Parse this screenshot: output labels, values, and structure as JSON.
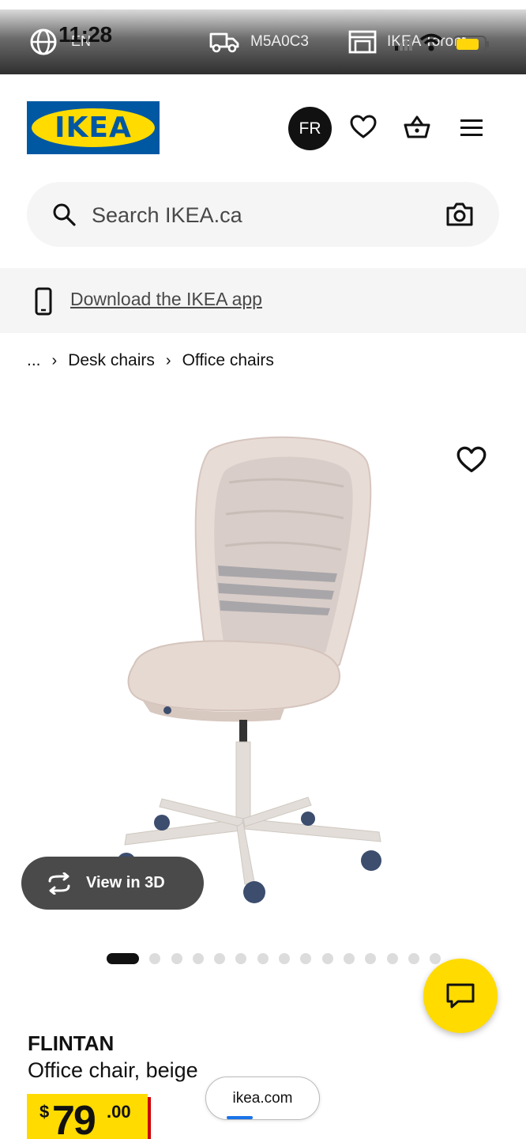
{
  "topbar": {
    "language": "EN",
    "time": "11:28",
    "postal_code": "M5A0C3",
    "store": "IKEA Toront..."
  },
  "header": {
    "logo_text": "IKEA",
    "lang_toggle": "FR",
    "icons": [
      "heart-icon",
      "basket-icon",
      "menu-icon"
    ]
  },
  "search": {
    "placeholder": "Search IKEA.ca"
  },
  "app_banner": {
    "link_text": "Download the IKEA app"
  },
  "breadcrumb": {
    "items": [
      "...",
      "Desk chairs",
      "Office chairs"
    ]
  },
  "gallery": {
    "view3d_label": "View in 3D",
    "image_count": 15,
    "active_index": 0
  },
  "product": {
    "name": "FLINTAN",
    "description": "Office chair, beige",
    "price_currency": "$",
    "price_integer": "79",
    "price_decimal": ".00"
  },
  "browser": {
    "url": "ikea.com"
  },
  "colors": {
    "ikea_blue": "#0058a3",
    "ikea_yellow": "#ffdb00",
    "price_shadow": "#cc0008"
  }
}
